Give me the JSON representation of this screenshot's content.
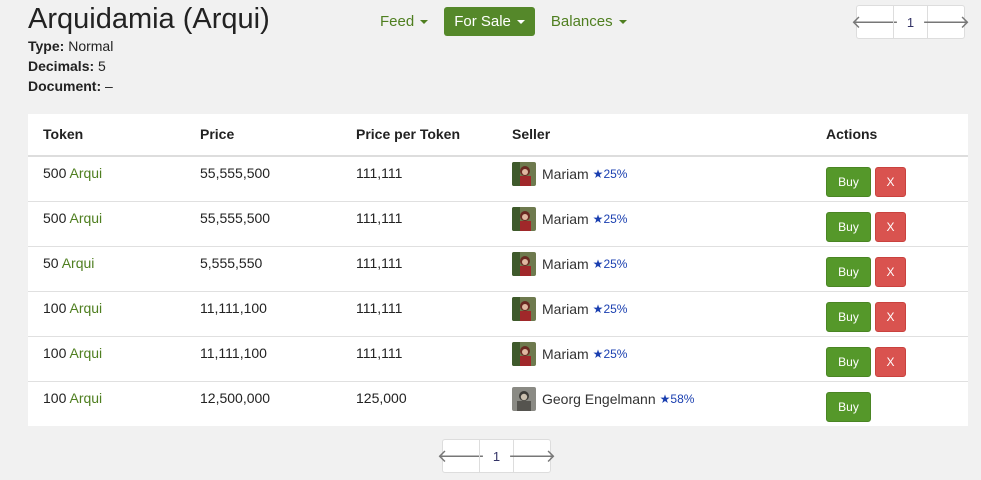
{
  "header": {
    "title": "Arquidamia (Arqui)",
    "type_label": "Type:",
    "type_value": "Normal",
    "decimals_label": "Decimals:",
    "decimals_value": "5",
    "document_label": "Document:",
    "document_value": "–"
  },
  "nav": {
    "feed": "Feed",
    "for_sale": "For Sale",
    "balances": "Balances"
  },
  "pagination": {
    "page": "1",
    "prev_icon": "arrow-left-icon",
    "next_icon": "arrow-right-icon"
  },
  "table": {
    "headers": {
      "token": "Token",
      "price": "Price",
      "price_per_token": "Price per Token",
      "seller": "Seller",
      "actions": "Actions"
    },
    "rows": [
      {
        "amount": "500",
        "symbol": "Arqui",
        "price": "55,555,500",
        "ppt": "111,111",
        "seller": "Mariam",
        "rating": "25%",
        "buy": "Buy",
        "cancel": "X"
      },
      {
        "amount": "500",
        "symbol": "Arqui",
        "price": "55,555,500",
        "ppt": "111,111",
        "seller": "Mariam",
        "rating": "25%",
        "buy": "Buy",
        "cancel": "X"
      },
      {
        "amount": "50",
        "symbol": "Arqui",
        "price": "5,555,550",
        "ppt": "111,111",
        "seller": "Mariam",
        "rating": "25%",
        "buy": "Buy",
        "cancel": "X"
      },
      {
        "amount": "100",
        "symbol": "Arqui",
        "price": "11,111,100",
        "ppt": "111,111",
        "seller": "Mariam",
        "rating": "25%",
        "buy": "Buy",
        "cancel": "X"
      },
      {
        "amount": "100",
        "symbol": "Arqui",
        "price": "11,111,100",
        "ppt": "111,111",
        "seller": "Mariam",
        "rating": "25%",
        "buy": "Buy",
        "cancel": "X"
      },
      {
        "amount": "100",
        "symbol": "Arqui",
        "price": "12,500,000",
        "ppt": "125,000",
        "seller": "Georg Engelmann",
        "rating": "58%",
        "buy": "Buy",
        "cancel": null
      }
    ]
  },
  "colors": {
    "accent": "#55882a",
    "link": "#4f7f20",
    "danger": "#d9534f",
    "rating": "#1a3fb0"
  }
}
